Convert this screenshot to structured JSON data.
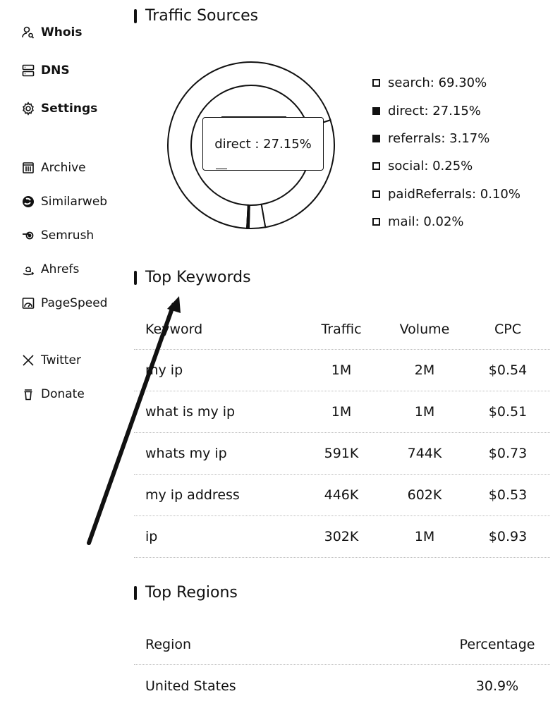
{
  "sidebar": {
    "items": [
      {
        "label": "Whois",
        "icon": "user-search-icon"
      },
      {
        "label": "DNS",
        "icon": "server-icon"
      },
      {
        "label": "Settings",
        "icon": "gear-icon"
      },
      {
        "label": "Archive",
        "icon": "archive-icon"
      },
      {
        "label": "Similarweb",
        "icon": "similarweb-icon"
      },
      {
        "label": "Semrush",
        "icon": "semrush-icon"
      },
      {
        "label": "Ahrefs",
        "icon": "amazon-icon"
      },
      {
        "label": "PageSpeed",
        "icon": "gauge-icon"
      },
      {
        "label": "Twitter",
        "icon": "x-icon"
      },
      {
        "label": "Donate",
        "icon": "cup-icon"
      }
    ]
  },
  "traffic": {
    "title": "Traffic Sources",
    "tooltip": "direct : 27.15%",
    "legend": [
      {
        "label": "search: 69.30%",
        "filled": false
      },
      {
        "label": "direct: 27.15%",
        "filled": true
      },
      {
        "label": "referrals: 3.17%",
        "filled": true
      },
      {
        "label": "social: 0.25%",
        "filled": false
      },
      {
        "label": "paidReferrals: 0.10%",
        "filled": false
      },
      {
        "label": "mail: 0.02%",
        "filled": false
      }
    ]
  },
  "chart_data": {
    "type": "pie",
    "categories": [
      "search",
      "direct",
      "referrals",
      "social",
      "paidReferrals",
      "mail"
    ],
    "values": [
      69.3,
      27.15,
      3.17,
      0.25,
      0.1,
      0.02
    ]
  },
  "keywords": {
    "title": "Top Keywords",
    "headers": {
      "keyword": "Keyword",
      "traffic": "Traffic",
      "volume": "Volume",
      "cpc": "CPC"
    },
    "rows": [
      {
        "keyword": "my ip",
        "traffic": "1M",
        "volume": "2M",
        "cpc": "$0.54"
      },
      {
        "keyword": "what is my ip",
        "traffic": "1M",
        "volume": "1M",
        "cpc": "$0.51"
      },
      {
        "keyword": "whats my ip",
        "traffic": "591K",
        "volume": "744K",
        "cpc": "$0.73"
      },
      {
        "keyword": "my ip address",
        "traffic": "446K",
        "volume": "602K",
        "cpc": "$0.53"
      },
      {
        "keyword": "ip",
        "traffic": "302K",
        "volume": "1M",
        "cpc": "$0.93"
      }
    ]
  },
  "regions": {
    "title": "Top Regions",
    "headers": {
      "region": "Region",
      "percentage": "Percentage"
    },
    "rows": [
      {
        "region": "United States",
        "percentage": "30.9%"
      }
    ]
  }
}
